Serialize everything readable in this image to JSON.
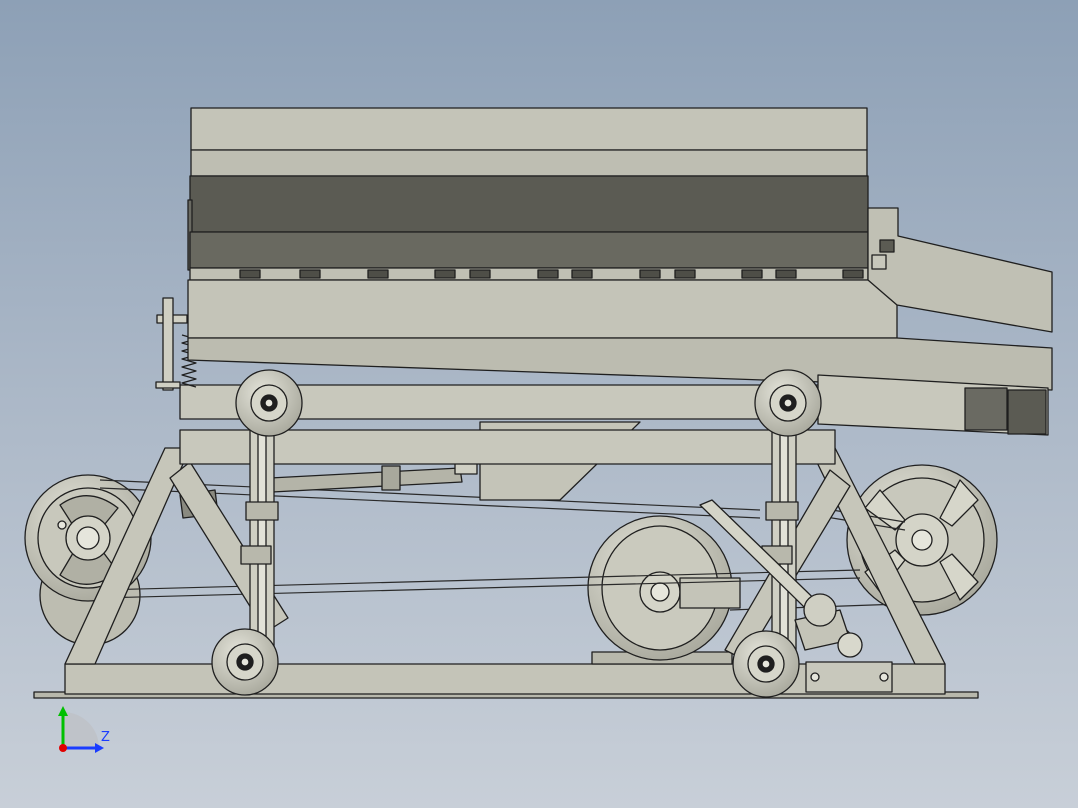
{
  "triad": {
    "z_label": "Z"
  },
  "colors": {
    "background_top": "#8da0b6",
    "background_bottom": "#c8cfd8",
    "part_fill": "#c0c0b4",
    "part_dark": "#5b5b53",
    "outline": "#1f1f1f",
    "axis_x": "#e00000",
    "axis_y": "#00c000",
    "axis_z": "#1a3cff"
  },
  "icons": {
    "triad": "coordinate-triad-icon"
  }
}
